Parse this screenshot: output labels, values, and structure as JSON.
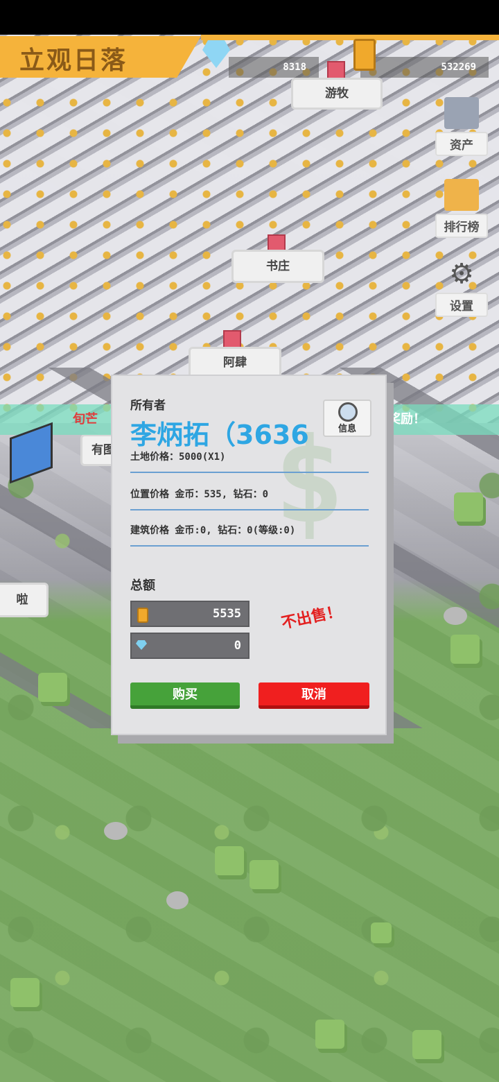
{
  "game": {
    "title": "立观日落",
    "resources": {
      "diamonds": "8318",
      "coins": "532269"
    }
  },
  "map_labels": {
    "bubble_1": "游牧",
    "bubble_2": "书庄",
    "bubble_3": "阿肆",
    "bubble_4": "有图",
    "bubble_5": "啦"
  },
  "side_menu": {
    "assets": "资产",
    "ranking": "排行榜",
    "settings": "设置"
  },
  "ticker": {
    "left": "旬芒",
    "right": "奖励！"
  },
  "dialog": {
    "owner_label": "所有者",
    "owner_name": "李炳拓（3636",
    "info_label": "信息",
    "land_price": "土地价格：5000(X1)",
    "location_price": "位置价格 金币：535, 钻石：0",
    "building_price": "建筑价格 金币:0, 钻石：0(等级:0)",
    "total_label": "总额",
    "total_coins": "5535",
    "total_diamonds": "0",
    "not_for_sale": "不出售！",
    "buy_label": "购买",
    "cancel_label": "取消"
  },
  "colors": {
    "accent_gold": "#f5b33b",
    "owner_name": "#2ea6e3",
    "buy_green": "#46a23a",
    "cancel_red": "#f01f1f",
    "not_for_sale_red": "#e32020"
  }
}
